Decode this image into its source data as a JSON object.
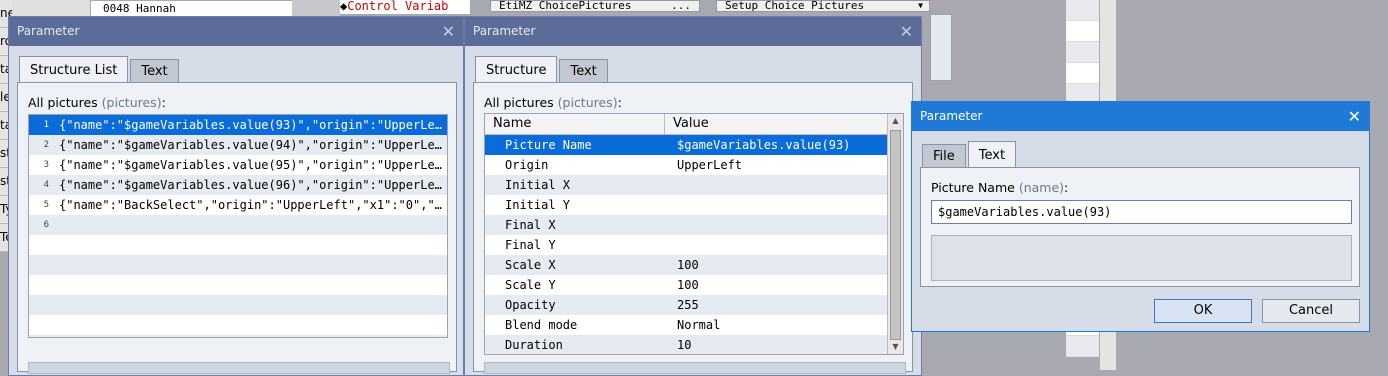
{
  "background": {
    "list_item": "0048 Hannah",
    "sidebar_fragments": [
      "nemies",
      "ro",
      "ta",
      "le",
      "ta",
      "st",
      "st",
      "Ty",
      "Te"
    ],
    "command_text": "Control Variab",
    "plugin_button": "EtiMZ_ChoicePictures",
    "plugin_dots": "...",
    "command_select": "Setup Choice Pictures"
  },
  "win1": {
    "title": "Parameter",
    "tabs": [
      "Structure List",
      "Text"
    ],
    "label": "All pictures",
    "label_key": "(pictures)",
    "label_suffix": ":",
    "rows": [
      {
        "num": "1",
        "text": "{\"name\":\"$gameVariables.value(93)\",\"origin\":\"UpperLe…"
      },
      {
        "num": "2",
        "text": "{\"name\":\"$gameVariables.value(94)\",\"origin\":\"UpperLe…"
      },
      {
        "num": "3",
        "text": "{\"name\":\"$gameVariables.value(95)\",\"origin\":\"UpperLe…"
      },
      {
        "num": "4",
        "text": "{\"name\":\"$gameVariables.value(96)\",\"origin\":\"UpperLe…"
      },
      {
        "num": "5",
        "text": "{\"name\":\"BackSelect\",\"origin\":\"UpperLeft\",\"x1\":\"0\",\"…"
      },
      {
        "num": "6",
        "text": ""
      },
      {
        "num": "",
        "text": ""
      },
      {
        "num": "",
        "text": ""
      },
      {
        "num": "",
        "text": ""
      },
      {
        "num": "",
        "text": ""
      },
      {
        "num": "",
        "text": ""
      },
      {
        "num": "",
        "text": ""
      }
    ]
  },
  "win2": {
    "title": "Parameter",
    "tabs": [
      "Structure",
      "Text"
    ],
    "label": "All pictures",
    "label_key": "(pictures)",
    "label_suffix": ":",
    "columns": [
      "Name",
      "Value"
    ],
    "rows": [
      {
        "name": "Picture Name",
        "value": "$gameVariables.value(93)"
      },
      {
        "name": "Origin",
        "value": "UpperLeft"
      },
      {
        "name": "Initial X",
        "value": ""
      },
      {
        "name": "Initial Y",
        "value": ""
      },
      {
        "name": "Final X",
        "value": ""
      },
      {
        "name": "Final Y",
        "value": ""
      },
      {
        "name": "Scale X",
        "value": "100"
      },
      {
        "name": "Scale Y",
        "value": "100"
      },
      {
        "name": "Opacity",
        "value": "255"
      },
      {
        "name": "Blend mode",
        "value": "Normal"
      },
      {
        "name": "Duration",
        "value": "10"
      }
    ]
  },
  "win3": {
    "title": "Parameter",
    "tabs": [
      "File",
      "Text"
    ],
    "label": "Picture Name",
    "label_key": "(name)",
    "label_suffix": ":",
    "input_value": "$gameVariables.value(93)",
    "ok": "OK",
    "cancel": "Cancel"
  },
  "colors": {
    "active_title": "#1e7ad6",
    "inactive_title": "#5d6b99",
    "selection": "#0a6cd8"
  }
}
